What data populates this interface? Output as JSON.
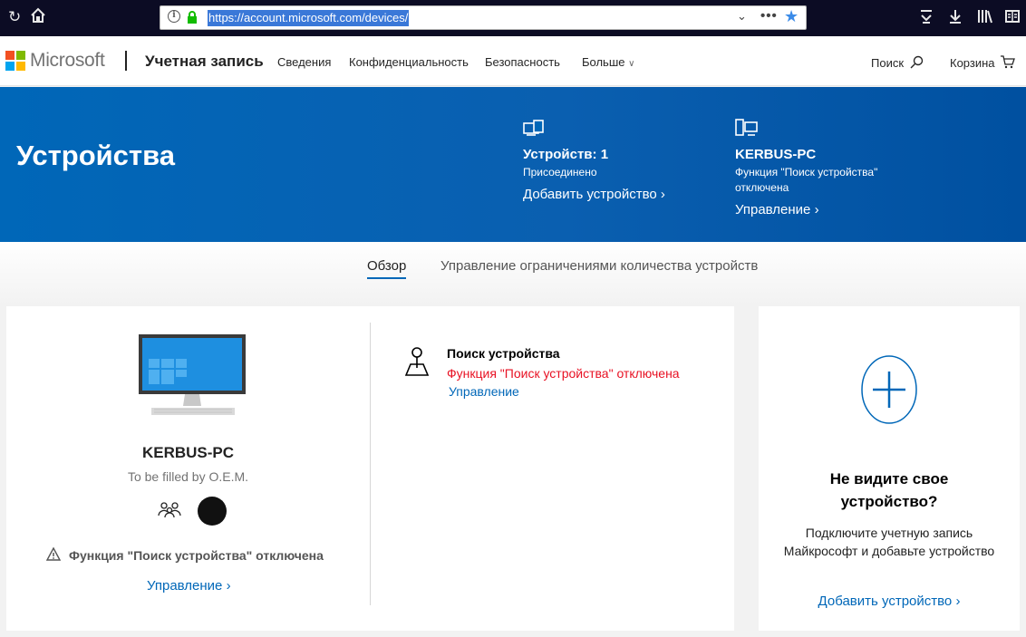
{
  "browser": {
    "url": "https://account.microsoft.com/devices/",
    "icons": [
      "reload-icon",
      "home-icon",
      "info-icon",
      "lock-icon",
      "chevron-down-icon",
      "more-icon",
      "bookmark-star-icon",
      "pocket-icon",
      "download-icon",
      "library-icon",
      "reader-icon"
    ]
  },
  "header": {
    "brand": "Microsoft",
    "section": "Учетная запись",
    "nav": [
      "Сведения",
      "Конфиденциальность",
      "Безопасность",
      "Больше"
    ],
    "search": "Поиск",
    "cart": "Корзина"
  },
  "hero": {
    "title": "Устройства",
    "devices_count": "Устройств: 1",
    "connected": "Присоединено",
    "add_device": "Добавить устройство",
    "pc_name": "KERBUS-PC",
    "find_status_line1": "Функция \"Поиск устройства\"",
    "find_status_line2": "отключена",
    "manage": "Управление"
  },
  "tabs": {
    "overview": "Обзор",
    "limits": "Управление ограничениями количества устройств"
  },
  "device": {
    "name": "KERBUS-PC",
    "model": "To be filled by O.E.M.",
    "warning": "Функция \"Поиск устройства\" отключена",
    "manage": "Управление",
    "find_title": "Поиск устройства",
    "find_status": "Функция \"Поиск устройства\" отключена",
    "find_manage": "Управление"
  },
  "add_card": {
    "title_line1": "Не видите свое",
    "title_line2": "устройство?",
    "desc": "Подключите учетную запись Майкрософт и добавьте устройство",
    "link": "Добавить устройство"
  },
  "colors": {
    "accent": "#0067b8",
    "error": "#e81123",
    "hero_bg": "#0067b8"
  }
}
